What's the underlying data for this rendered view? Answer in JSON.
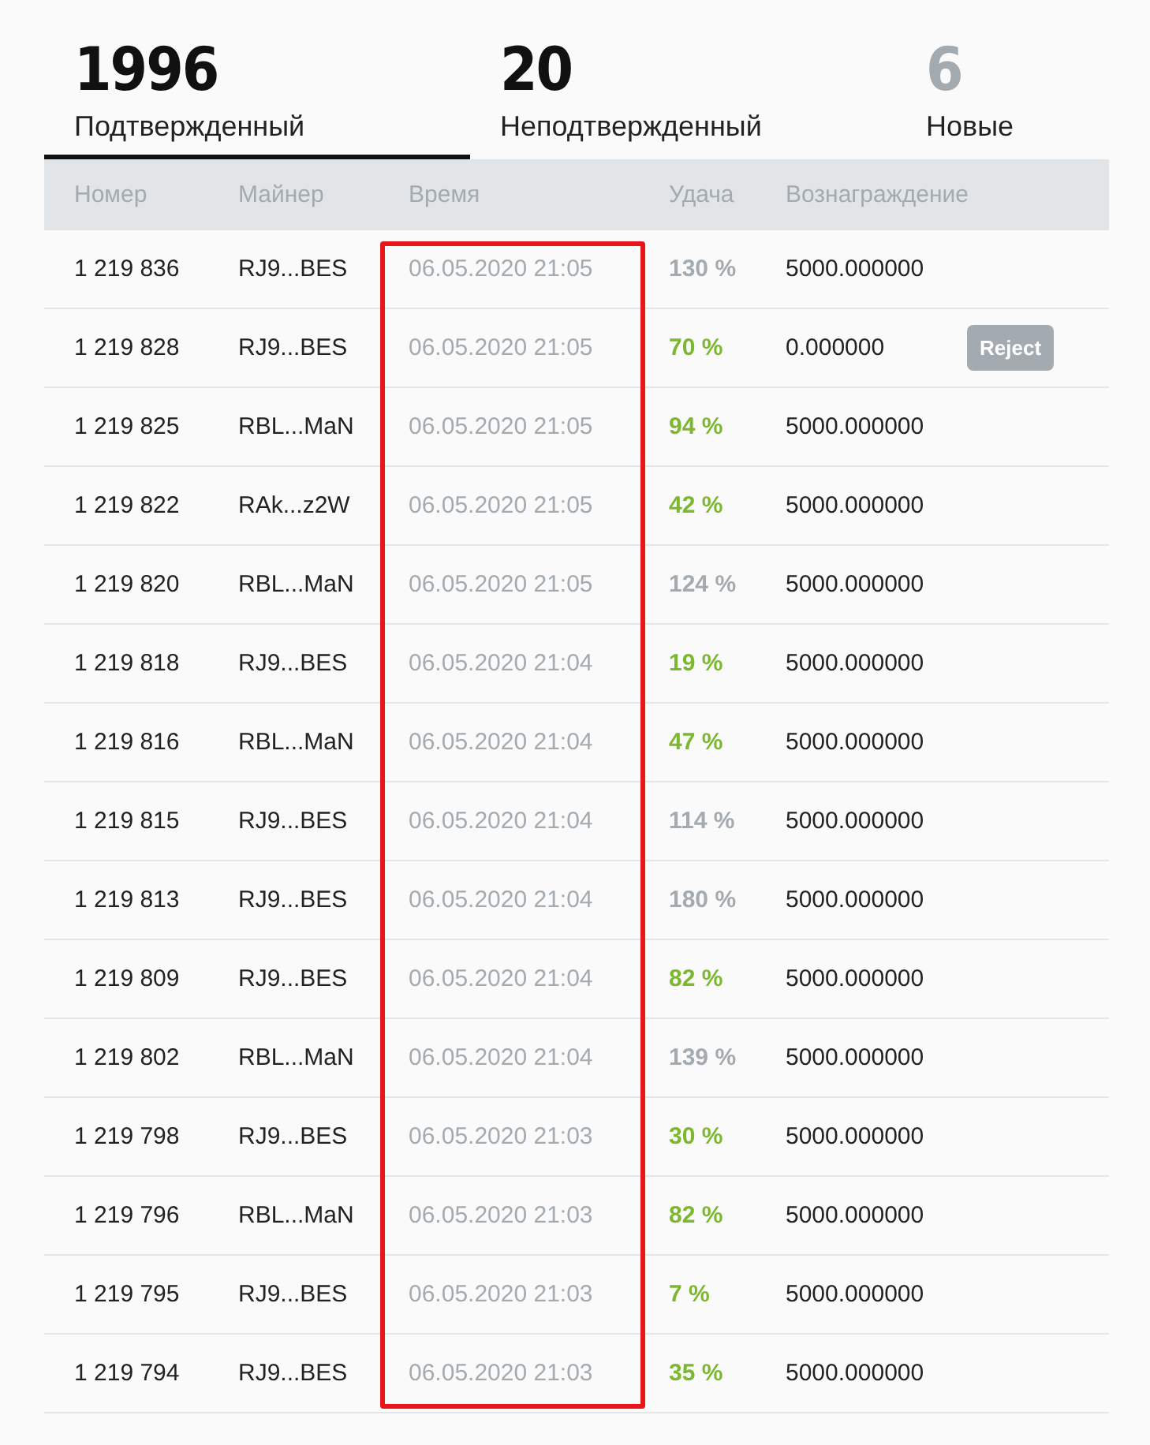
{
  "tabs": [
    {
      "count": "1996",
      "label": "Подтвержденный",
      "selected": true
    },
    {
      "count": "20",
      "label": "Неподтвержденный",
      "selected": false
    },
    {
      "count": "6",
      "label": "Новые",
      "selected": false
    }
  ],
  "table": {
    "columns": [
      {
        "label": "Номер",
        "highlighted": false
      },
      {
        "label": "Майнер",
        "highlighted": false
      },
      {
        "label": "Время",
        "highlighted": true
      },
      {
        "label": "Удача",
        "highlighted": false
      },
      {
        "label": "Вознаграждение",
        "highlighted": false
      }
    ],
    "rows": [
      {
        "number": "1 219 836",
        "miner": "RJ9...BES",
        "time": "06.05.2020 21:05",
        "luck": "130 %",
        "color": "#a3aab0",
        "reward": "5000.000000"
      },
      {
        "number": "1 219 828",
        "miner": "RJ9...BES",
        "time": "06.05.2020 21:05",
        "luck": "70 %",
        "color": "#7cb82f",
        "reward": "0.000000",
        "action": "Reject"
      },
      {
        "number": "1 219 825",
        "miner": "RBL...MaN",
        "time": "06.05.2020 21:05",
        "luck": "94 %",
        "color": "#7cb82f",
        "reward": "5000.000000"
      },
      {
        "number": "1 219 822",
        "miner": "RAk...z2W",
        "time": "06.05.2020 21:05",
        "luck": "42 %",
        "color": "#7cb82f",
        "reward": "5000.000000"
      },
      {
        "number": "1 219 820",
        "miner": "RBL...MaN",
        "time": "06.05.2020 21:05",
        "luck": "124 %",
        "color": "#a3aab0",
        "reward": "5000.000000"
      },
      {
        "number": "1 219 818",
        "miner": "RJ9...BES",
        "time": "06.05.2020 21:04",
        "luck": "19 %",
        "color": "#7cb82f",
        "reward": "5000.000000"
      },
      {
        "number": "1 219 816",
        "miner": "RBL...MaN",
        "time": "06.05.2020 21:04",
        "luck": "47 %",
        "color": "#7cb82f",
        "reward": "5000.000000"
      },
      {
        "number": "1 219 815",
        "miner": "RJ9...BES",
        "time": "06.05.2020 21:04",
        "luck": "114 %",
        "color": "#a3aab0",
        "reward": "5000.000000"
      },
      {
        "number": "1 219 813",
        "miner": "RJ9...BES",
        "time": "06.05.2020 21:04",
        "luck": "180 %",
        "color": "#a3aab0",
        "reward": "5000.000000"
      },
      {
        "number": "1 219 809",
        "miner": "RJ9...BES",
        "time": "06.05.2020 21:04",
        "luck": "82 %",
        "color": "#7cb82f",
        "reward": "5000.000000"
      },
      {
        "number": "1 219 802",
        "miner": "RBL...MaN",
        "time": "06.05.2020 21:04",
        "luck": "139 %",
        "color": "#a3aab0",
        "reward": "5000.000000"
      },
      {
        "number": "1 219 798",
        "miner": "RJ9...BES",
        "time": "06.05.2020 21:03",
        "luck": "30 %",
        "color": "#7cb82f",
        "reward": "5000.000000"
      },
      {
        "number": "1 219 796",
        "miner": "RBL...MaN",
        "time": "06.05.2020 21:03",
        "luck": "82 %",
        "color": "#7cb82f",
        "reward": "5000.000000"
      },
      {
        "number": "1 219 795",
        "miner": "RJ9...BES",
        "time": "06.05.2020 21:03",
        "luck": "7 %",
        "color": "#7cb82f",
        "reward": "5000.000000"
      },
      {
        "number": "1 219 794",
        "miner": "RJ9...BES",
        "time": "06.05.2020 21:03",
        "luck": "35 %",
        "color": "#7cb82f",
        "reward": "5000.000000"
      }
    ]
  }
}
